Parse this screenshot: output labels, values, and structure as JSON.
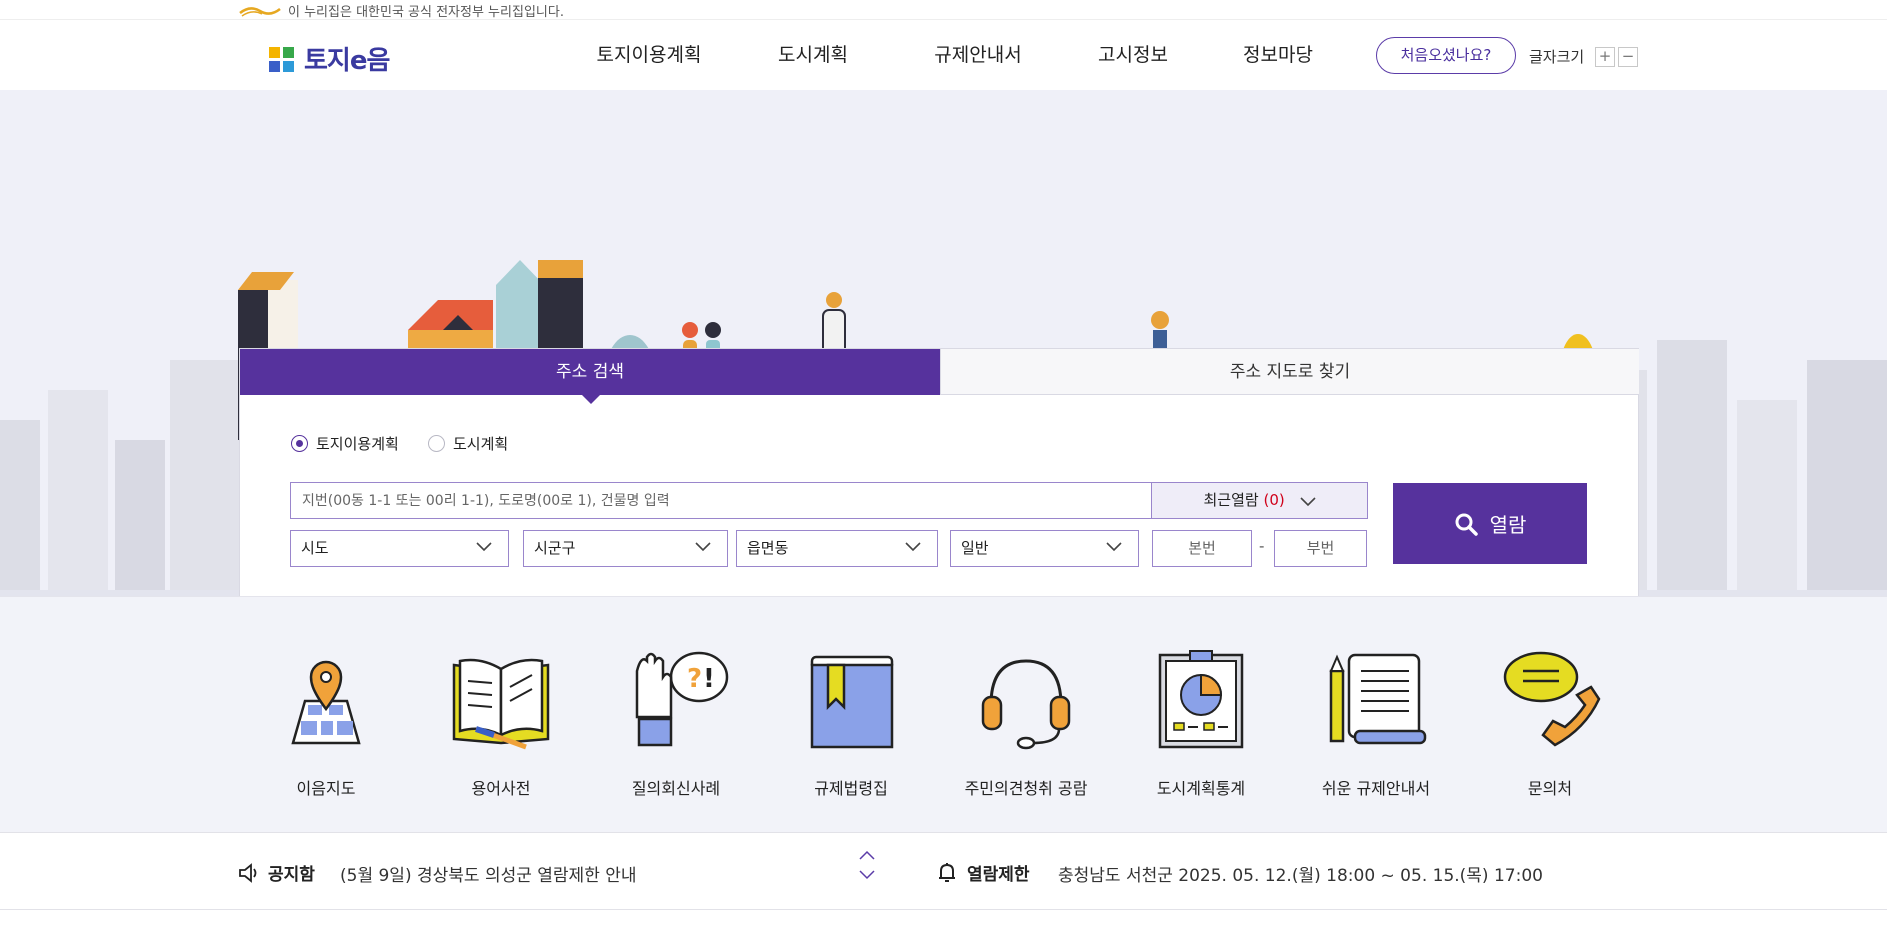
{
  "gov_banner": {
    "text": "이 누리집은 대한민국 공식 전자정부 누리집입니다."
  },
  "header": {
    "logo_text": "토지e음",
    "nav": [
      "토지이용계획",
      "도시계획",
      "규제안내서",
      "고시정보",
      "정보마당"
    ],
    "first_visit_button": "처음오셨나요?",
    "font_size_label": "글자크기",
    "font_plus": "+",
    "font_minus": "−"
  },
  "search": {
    "tabs": [
      "주소 검색",
      "주소 지도로 찾기"
    ],
    "active_tab": "주소 검색",
    "radio_options": [
      {
        "label": "토지이용계획",
        "checked": true
      },
      {
        "label": "도시계획",
        "checked": false
      }
    ],
    "address_placeholder": "지번(00동 1-1 또는 00리 1-1), 도로명(00로 1), 건물명 입력",
    "recent_label": "최근열람",
    "recent_count": "(0)",
    "search_button": "열람",
    "selects": [
      "시도",
      "시군구",
      "읍면동",
      "일반"
    ],
    "main_number_placeholder": "본번",
    "sub_number_placeholder": "부번",
    "dash": "-"
  },
  "quick_menu": [
    {
      "label": "이음지도",
      "icon": "map-pin-icon"
    },
    {
      "label": "용어사전",
      "icon": "open-book-icon"
    },
    {
      "label": "질의회신사례",
      "icon": "raised-hand-question-icon"
    },
    {
      "label": "규제법령집",
      "icon": "bookmarked-book-icon"
    },
    {
      "label": "주민의견청취 공람",
      "icon": "headset-icon"
    },
    {
      "label": "도시계획통계",
      "icon": "pie-chart-board-icon"
    },
    {
      "label": "쉬운 규제안내서",
      "icon": "scroll-document-icon"
    },
    {
      "label": "문의처",
      "icon": "phone-chat-icon"
    }
  ],
  "notice": {
    "title": "공지함",
    "text": "(5월 9일) 경상북도 의성군 열람제한 안내",
    "restriction_title": "열람제한",
    "restriction_text": "충청남도 서천군 2025. 05. 12.(월) 18:00 ~ 05. 15.(목) 17:00"
  },
  "colors": {
    "primary": "#56329d",
    "recent_count": "#d0021b",
    "hero_bg": "#eff0f8"
  }
}
